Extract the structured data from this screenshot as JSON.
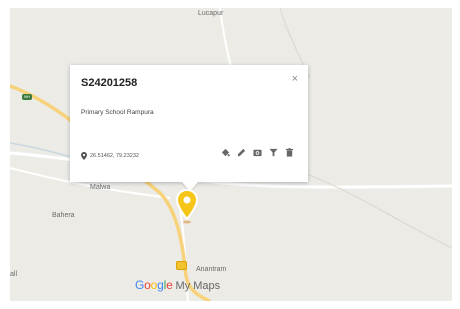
{
  "map": {
    "places": {
      "top": "Lucapur",
      "malwa": "Malwa",
      "bahera": "Bahera",
      "anantram": "Anantram",
      "left_edge": "all"
    },
    "shield_label": "NH",
    "brand": {
      "google": [
        "G",
        "o",
        "o",
        "g",
        "l",
        "e"
      ],
      "my_maps": "My Maps"
    },
    "brand_colors": [
      "#4285F4",
      "#EA4335",
      "#FBBC05",
      "#4285F4",
      "#34A853",
      "#EA4335"
    ]
  },
  "popup": {
    "title": "S24201258",
    "description": "Primary School Rampura",
    "coordinates": "26.51462, 79.23232",
    "close_symbol": "×",
    "actions": [
      "style-icon",
      "edit-icon",
      "camera-icon",
      "filter-icon",
      "delete-icon"
    ]
  },
  "marker": {
    "color": "#f5c518"
  }
}
